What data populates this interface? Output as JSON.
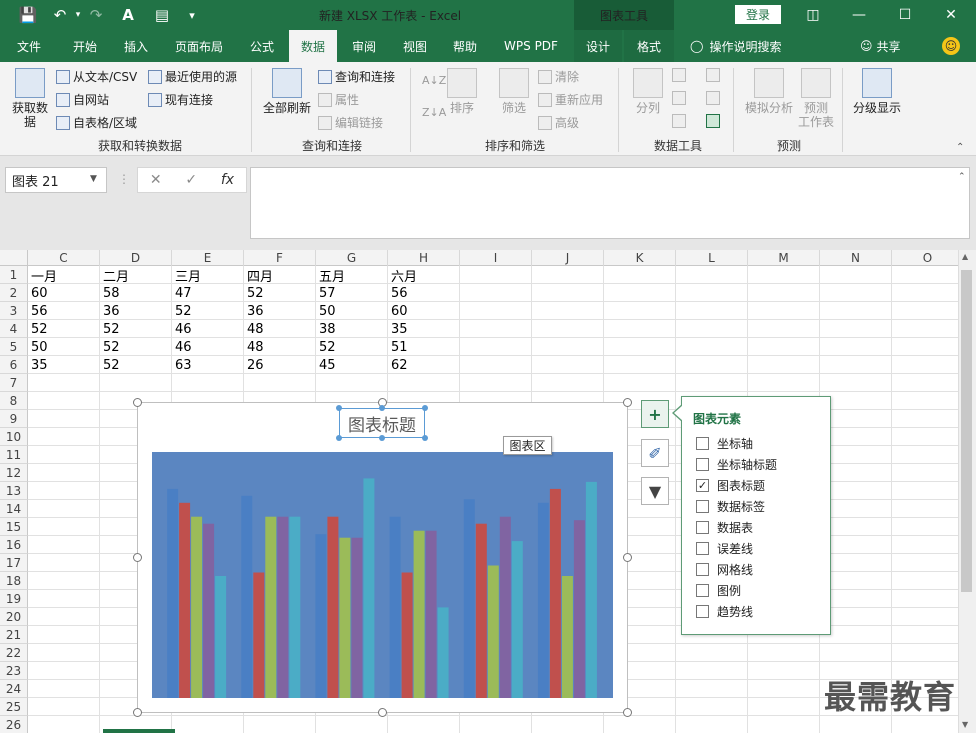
{
  "window": {
    "doc_title": "新建 XLSX 工作表  -  Excel",
    "context_title": "图表工具",
    "login": "登录"
  },
  "tabs": [
    "文件",
    "开始",
    "插入",
    "页面布局",
    "公式",
    "数据",
    "审阅",
    "视图",
    "帮助",
    "WPS PDF",
    "设计",
    "格式"
  ],
  "active_tab": "数据",
  "tell_me": "操作说明搜索",
  "share": "共享",
  "ribbon": {
    "get_data": {
      "big": "获取数\n据",
      "from_text": "从文本/CSV",
      "from_web": "自网站",
      "from_table": "自表格/区域",
      "recent": "最近使用的源",
      "existing": "现有连接",
      "label": "获取和转换数据"
    },
    "queries": {
      "refresh": "全部刷新",
      "queries_conn": "查询和连接",
      "properties": "属性",
      "edit_links": "编辑链接",
      "label": "查询和连接"
    },
    "sort": {
      "sort": "排序",
      "filter": "筛选",
      "clear": "清除",
      "reapply": "重新应用",
      "advanced": "高级",
      "label": "排序和筛选"
    },
    "tools": {
      "split": "分列",
      "label": "数据工具"
    },
    "forecast": {
      "whatif": "模拟分析",
      "sheet": "预测\n工作表",
      "label": "预测"
    },
    "outline": {
      "label": "分级显示"
    }
  },
  "namebox": "图表 21",
  "columns": [
    "C",
    "D",
    "E",
    "F",
    "G",
    "H",
    "I",
    "J",
    "K",
    "L",
    "M",
    "N",
    "O"
  ],
  "rows": [
    "1",
    "2",
    "3",
    "4",
    "5",
    "6",
    "7",
    "8",
    "9",
    "10",
    "11",
    "12",
    "13",
    "14",
    "15",
    "16",
    "17",
    "18",
    "19",
    "20",
    "21",
    "22",
    "23",
    "24",
    "25",
    "26"
  ],
  "table": [
    [
      "一月",
      "二月",
      "三月",
      "四月",
      "五月",
      "六月"
    ],
    [
      "60",
      "58",
      "47",
      "52",
      "57",
      "56"
    ],
    [
      "56",
      "36",
      "52",
      "36",
      "50",
      "60"
    ],
    [
      "52",
      "52",
      "46",
      "48",
      "38",
      "35"
    ],
    [
      "50",
      "52",
      "46",
      "48",
      "52",
      "51"
    ],
    [
      "35",
      "52",
      "63",
      "26",
      "45",
      "62"
    ]
  ],
  "chart": {
    "title": "图表标题",
    "tooltip": "图表区",
    "colors": [
      "#4a7fc4",
      "#c0504d",
      "#9bbb59",
      "#8064a2",
      "#4bacc6"
    ]
  },
  "chart_data": {
    "type": "bar",
    "categories": [
      "一月",
      "二月",
      "三月",
      "四月",
      "五月",
      "六月"
    ],
    "series": [
      {
        "values": [
          60,
          58,
          47,
          52,
          57,
          56
        ]
      },
      {
        "values": [
          56,
          36,
          52,
          36,
          50,
          60
        ]
      },
      {
        "values": [
          52,
          52,
          46,
          48,
          38,
          35
        ]
      },
      {
        "values": [
          50,
          52,
          46,
          48,
          52,
          51
        ]
      },
      {
        "values": [
          35,
          52,
          63,
          26,
          45,
          62
        ]
      }
    ],
    "title": "图表标题",
    "ylim": [
      0,
      70
    ]
  },
  "chart_elements": {
    "title": "图表元素",
    "items": [
      {
        "label": "坐标轴",
        "checked": false
      },
      {
        "label": "坐标轴标题",
        "checked": false
      },
      {
        "label": "图表标题",
        "checked": true
      },
      {
        "label": "数据标签",
        "checked": false
      },
      {
        "label": "数据表",
        "checked": false
      },
      {
        "label": "误差线",
        "checked": false
      },
      {
        "label": "网格线",
        "checked": false
      },
      {
        "label": "图例",
        "checked": false
      },
      {
        "label": "趋势线",
        "checked": false
      }
    ]
  },
  "watermark": "最需教育"
}
